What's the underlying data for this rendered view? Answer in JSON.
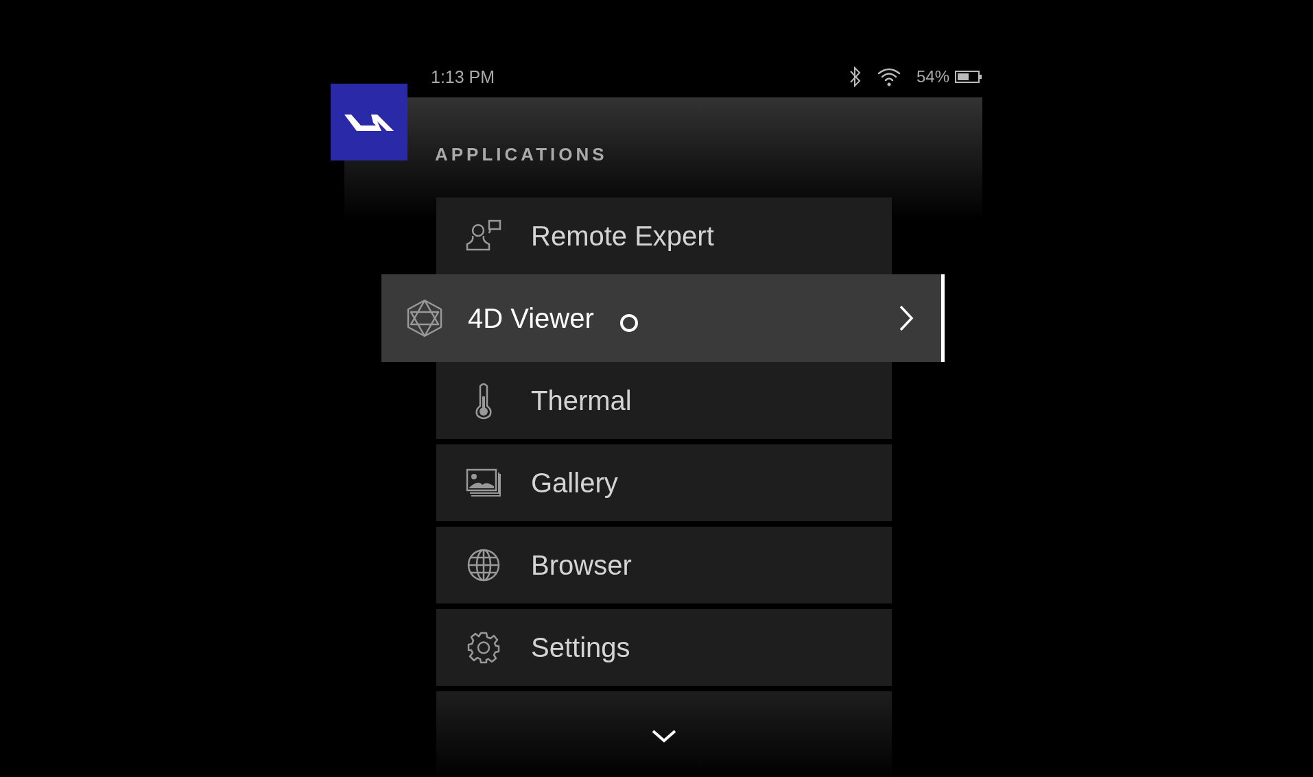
{
  "status_bar": {
    "time": "1:13 PM",
    "battery": "54%"
  },
  "header": {
    "title": "APPLICATIONS"
  },
  "menu": [
    {
      "label": "Remote Expert",
      "selected": false
    },
    {
      "label": "4D Viewer",
      "selected": true
    },
    {
      "label": "Thermal",
      "selected": false
    },
    {
      "label": "Gallery",
      "selected": false
    },
    {
      "label": "Browser",
      "selected": false
    },
    {
      "label": "Settings",
      "selected": false
    }
  ]
}
